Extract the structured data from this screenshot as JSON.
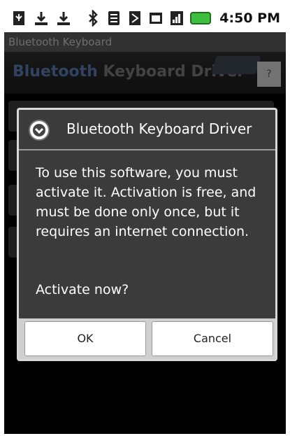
{
  "status_bar": {
    "time": "4:50 PM",
    "icons": [
      "usb-icon",
      "download-icon",
      "download-icon",
      "bluetooth-icon",
      "wifi-icon",
      "nfc-icon",
      "sdcard-icon",
      "signal-icon",
      "battery-icon"
    ]
  },
  "app": {
    "window_title": "Bluetooth Keyboard",
    "header_title_part1": "Bluetooth",
    "header_title_part2": " Keyboard Driver",
    "help_label": "?"
  },
  "dialog": {
    "title": "Bluetooth Keyboard Driver",
    "message": "To use this software, you must activate it. Activation is free, and must be done only once, but it requires an internet connection.",
    "question": "Activate now?",
    "ok_label": "OK",
    "cancel_label": "Cancel"
  },
  "colors": {
    "header_title_blue": "#5a7bb0",
    "dialog_bg": "#3b3b3b",
    "battery_green": "#3fbf3f"
  }
}
